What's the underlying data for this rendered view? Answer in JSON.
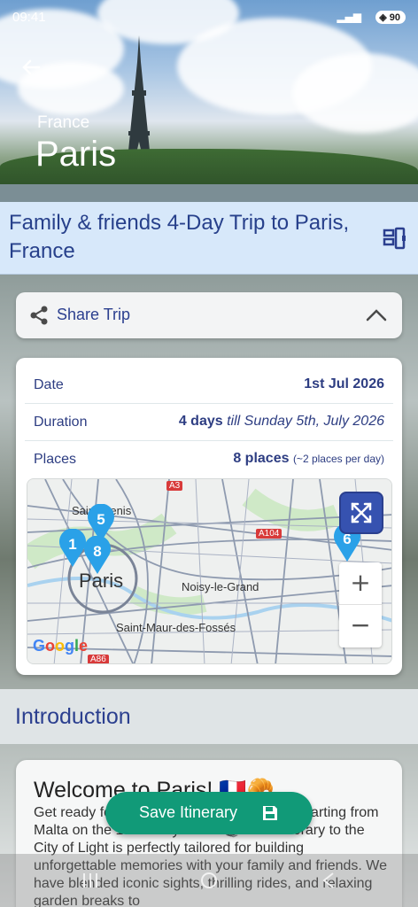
{
  "status_bar": {
    "time": "09:41",
    "battery": "90"
  },
  "hero": {
    "country": "France",
    "city": "Paris"
  },
  "trip": {
    "title": "Family & friends 4-Day Trip to Paris, France"
  },
  "share": {
    "label": "Share Trip"
  },
  "details": {
    "date_label": "Date",
    "date_value": "1st Jul 2026",
    "duration_label": "Duration",
    "duration_days": "4 days",
    "duration_till": "till",
    "duration_end": "Sunday 5th, July 2026",
    "places_label": "Places",
    "places_count": "8 places",
    "places_rate": "(~2 places per day)"
  },
  "map": {
    "labels": {
      "saint_denis": "Saint-Denis",
      "paris": "Paris",
      "noisy": "Noisy-le-Grand",
      "saint_maur": "Saint-Maur-des-Fossés"
    },
    "road_badges": [
      "A3",
      "A104",
      "A86"
    ],
    "pins": [
      "5",
      "1",
      "8",
      "6"
    ],
    "zoom_in": "+",
    "zoom_out": "−",
    "attribution": "Google"
  },
  "introduction": {
    "heading": "Introduction",
    "welcome": "Welcome to Paris! 🇫🇷🥐",
    "text": "Get ready for an exciting family adventure starting from Malta on the 1st of July 2026! 🛫 This itinerary to the City of Light is perfectly tailored for building unforgettable memories with your family and friends. We have blended iconic sights, thrilling rides, and relaxing garden breaks to"
  },
  "save_button": {
    "label": "Save Itinerary"
  },
  "colors": {
    "brand_blue": "#2b3f8f",
    "save_green": "#119a78",
    "pin_blue": "#2aa1e8"
  }
}
